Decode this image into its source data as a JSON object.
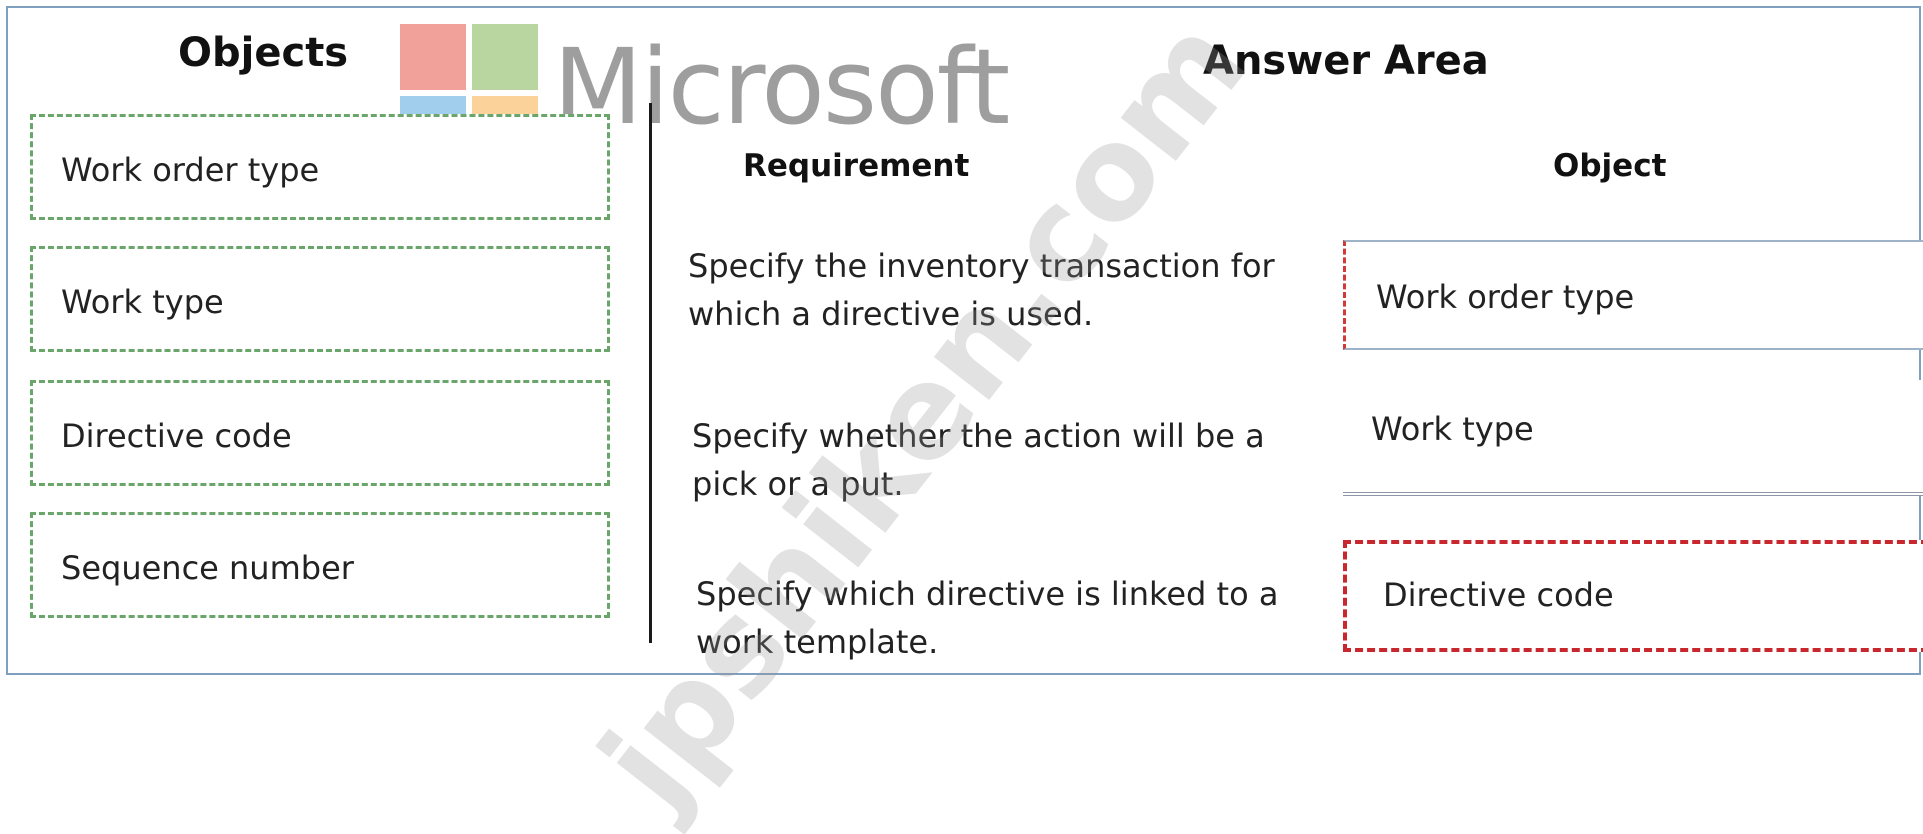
{
  "objects": {
    "title": "Objects",
    "items": [
      "Work order type",
      "Work type",
      "Directive code",
      "Sequence number"
    ]
  },
  "answer_area": {
    "title": "Answer Area",
    "col_requirement": "Requirement",
    "col_object": "Object",
    "rows": [
      {
        "requirement": "Specify the inventory transaction for which a directive is used.",
        "object": "Work order type"
      },
      {
        "requirement": "Specify whether the action will be a pick or a put.",
        "object": "Work type"
      },
      {
        "requirement": "Specify which directive is linked to a work template.",
        "object": "Directive code"
      }
    ]
  },
  "logo": {
    "wordmark": "Microsoft",
    "icon": "microsoft-logo-icon"
  },
  "watermark": "jpshiken.com",
  "colors": {
    "source_box_border": "#6aa66a",
    "answer_dashed_border": "#c8282d",
    "frame_border": "#7f9fbf"
  }
}
